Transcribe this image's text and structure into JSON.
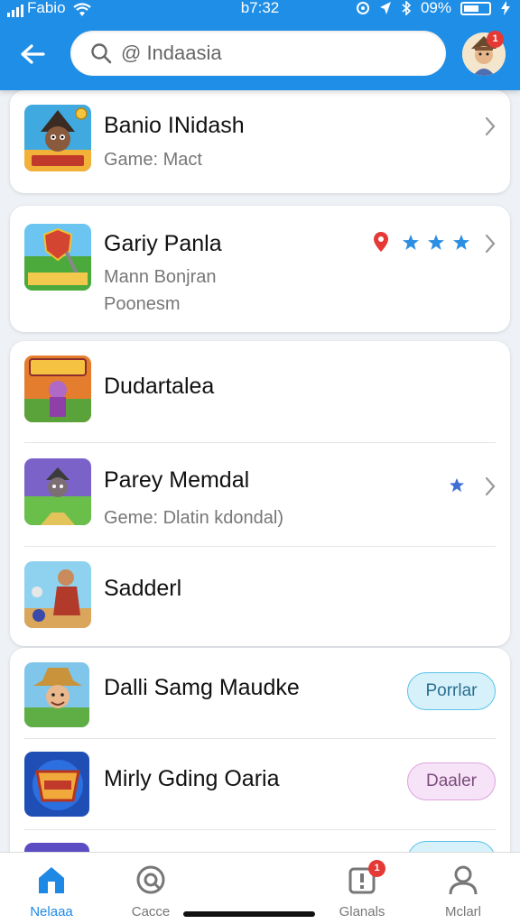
{
  "status_bar": {
    "carrier": "Fabio",
    "time": "b7:32",
    "battery_percent": "09%"
  },
  "search": {
    "placeholder": "@ Indaasia"
  },
  "profile": {
    "badge_count": "1"
  },
  "list": [
    {
      "title": "Banio INidash",
      "subtitle": "Game: Mact",
      "chevron": true
    },
    {
      "title": "Gariy Panla",
      "subtitle": "Mann Bonjran",
      "subtitle2": "Poonesm",
      "chevron": true,
      "rating_stars": 3,
      "has_location_pin": true
    },
    {
      "title": "Dudartalea"
    },
    {
      "title": "Parey Memdal",
      "subtitle": "Geme: Dlatin kdondal)",
      "chevron": true,
      "rating_stars": 1
    },
    {
      "title": "Sadderl"
    },
    {
      "title": "Dalli Samg Maudke",
      "button": "Porrlar"
    },
    {
      "title": "Mirly Gding Oaria",
      "button": "Daaler"
    }
  ],
  "bottom_nav": [
    {
      "label": "Nelaaa",
      "icon": "home-icon",
      "active": true
    },
    {
      "label": "Cacce",
      "icon": "explore-icon",
      "active": false
    },
    {
      "label": "Glanals",
      "icon": "notifications-icon",
      "active": false,
      "badge": "1"
    },
    {
      "label": "Mclarl",
      "icon": "profile-icon",
      "active": false
    }
  ],
  "colors": {
    "header": "#1f8ee6",
    "accent": "#1e88e5",
    "star": "#2d8fe3",
    "badge": "#e53935"
  }
}
